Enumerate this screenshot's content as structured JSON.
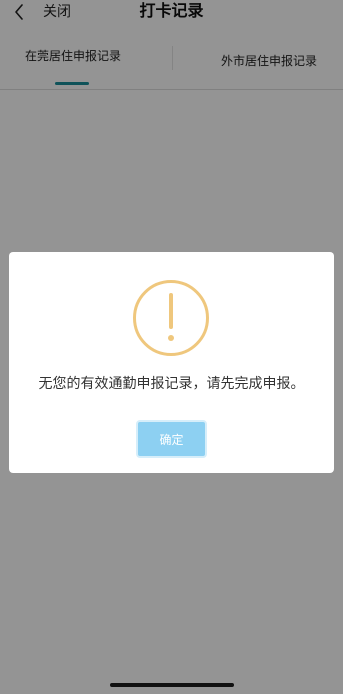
{
  "navbar": {
    "close_label": "关闭",
    "title": "打卡记录"
  },
  "tabs": [
    {
      "label": "在莞居住申报记录",
      "active": true
    },
    {
      "label": "外市居住申报记录",
      "active": false
    }
  ],
  "dialog": {
    "message": "无您的有效通勤申报记录，请先完成申报。",
    "confirm_label": "确定",
    "icon": "exclamation-circle-icon"
  },
  "colors": {
    "tab_indicator": "#1a8e9a",
    "warning_icon": "#efc77d",
    "confirm_button": "#8dd0f2",
    "overlay": "rgba(0,0,0,0.42)"
  }
}
